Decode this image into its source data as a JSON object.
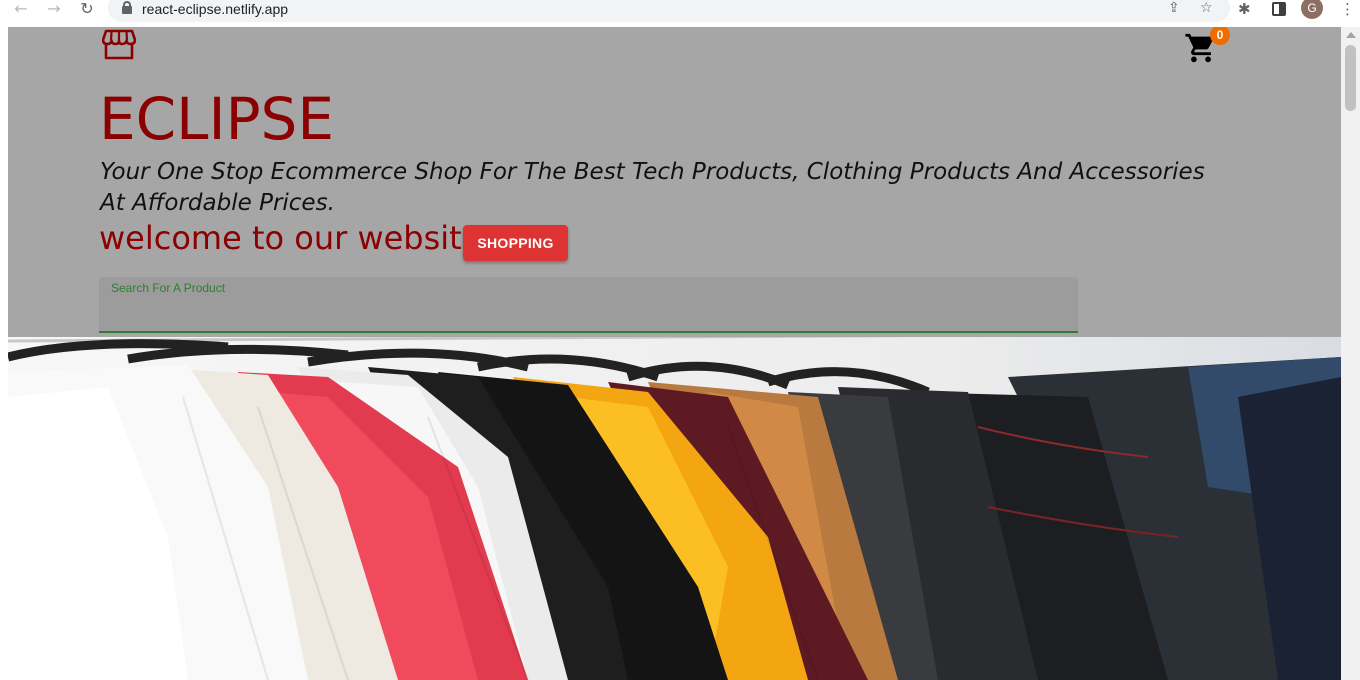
{
  "browser": {
    "url": "react-eclipse.netlify.app",
    "profile_initial": "G",
    "icons": {
      "back": "arrow-left-icon",
      "forward": "arrow-right-icon",
      "reload": "reload-icon",
      "lock": "lock-icon",
      "share": "share-icon",
      "bookmark": "star-icon",
      "extensions": "puzzle-icon",
      "side_panel": "side-panel-icon",
      "menu": "kebab-menu-icon"
    }
  },
  "header": {
    "store_icon": "storefront-icon",
    "cart_icon": "shopping-cart-icon",
    "cart_count": "0"
  },
  "hero": {
    "title": "ECLIPSE",
    "tagline": "Your One Stop Ecommerce Shop For The Best Tech Products, Clothing Products And Accessories At Affordable Prices.",
    "welcome": "welcome to our website",
    "shop_button": "SHOPPING",
    "search_label": "Search For A Product",
    "search_value": ""
  },
  "colors": {
    "brand": "#8b0000",
    "button": "#dd3333",
    "header_bg": "#a6a6a6",
    "search_accent": "#2e7d32",
    "badge": "#ef6c00"
  },
  "banner_image": "clothing-rack-tshirts-image"
}
